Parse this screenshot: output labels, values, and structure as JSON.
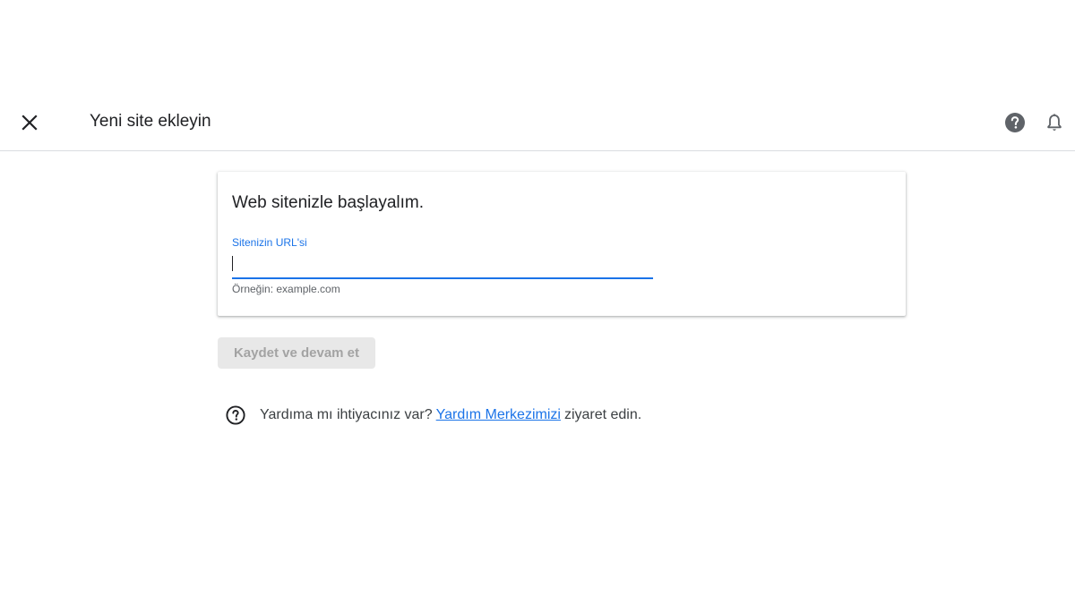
{
  "header": {
    "title": "Yeni site ekleyin",
    "icons": [
      "close-icon",
      "help-icon",
      "bell-icon"
    ]
  },
  "card": {
    "title": "Web sitenizle başlayalım.",
    "url_field": {
      "label": "Sitenizin URL'si",
      "value": "",
      "placeholder": "",
      "helper": "Örneğin: example.com"
    }
  },
  "actions": {
    "save_label": "Kaydet ve devam et"
  },
  "help": {
    "prefix": "Yardıma mı ihtiyacınız var?",
    "link_text": "Yardım Merkezimizi",
    "suffix": "ziyaret edin."
  },
  "colors": {
    "accent": "#1a73e8",
    "disabled_button_bg": "#e8e8e8",
    "disabled_button_text": "#a3a3a3",
    "divider": "#dadce0"
  }
}
